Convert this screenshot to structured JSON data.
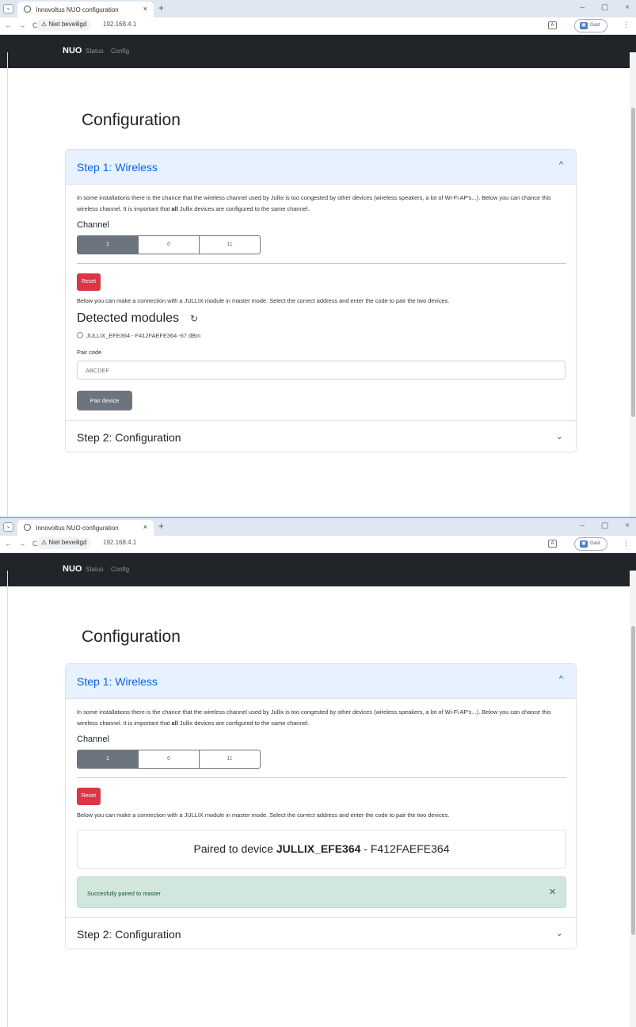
{
  "browser": {
    "tab_title": "Innovoltus NUO configuration",
    "tab_close": "×",
    "new_tab": "+",
    "window_controls": "–  ▢  ×",
    "nav_buttons": "← → C",
    "security_label": "⚠ Niet beveiligd",
    "url": "192.168.4.1",
    "profile_label": "Gast",
    "menu": "⋮"
  },
  "navbar": {
    "brand": "NUO",
    "links": [
      "Status",
      "Config"
    ]
  },
  "page": {
    "title": "Configuration"
  },
  "step1": {
    "title": "Step 1: Wireless",
    "intro_before_bold": "In some installations there is the chance that the wireless channel used by Jullix is too congested by other devices (wireless speakers, a lot of Wi-Fi AP's...). Below you can chance this wireless channel. It is important that ",
    "intro_bold": "all",
    "intro_after_bold": " Jullix devices are configured to the same channel.",
    "channel_label": "Channel",
    "channels": [
      "1",
      "6",
      "11"
    ],
    "selected_channel": "1",
    "reset_label": "Reset",
    "pair_intro": "Below you can make a connection with a JULLIX module in master mode. Select the correct address and enter the code to pair the two devices."
  },
  "before": {
    "detected_title": "Detected modules",
    "module_option": "JULLIX_EFE364 - F412FAEFE364 -67 dBm",
    "pair_code_label": "Pair code",
    "pair_code_placeholder": "ABCDEF",
    "pair_button": "Pair device"
  },
  "after": {
    "paired_prefix": "Paired to device ",
    "paired_device": "JULLIX_EFE364",
    "paired_suffix": " - F412FAEFE364",
    "success_message": "Succesfully paired to master",
    "success_close": "×"
  },
  "step2": {
    "title": "Step 2: Configuration"
  },
  "icons": {
    "chevron_up": "^",
    "chevron_down": "⌄",
    "refresh": "↻",
    "translate": "A"
  },
  "colors": {
    "navbar": "#212529",
    "accordion_active": "#e7f1ff",
    "accent": "#0c63e4",
    "danger": "#dc3545",
    "secondary": "#6c757d",
    "success_bg": "#d1e7dd"
  }
}
